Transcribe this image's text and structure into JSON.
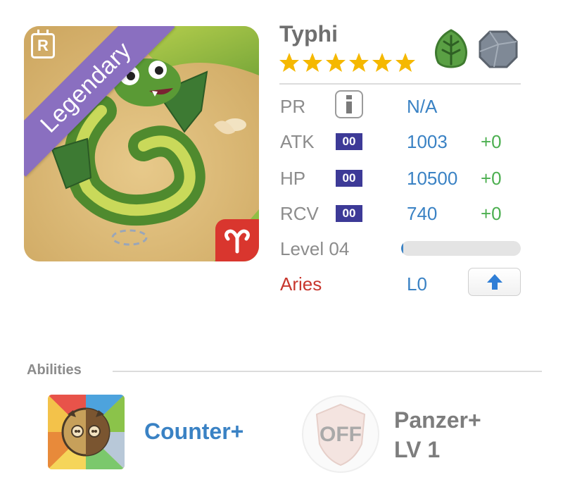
{
  "monster": {
    "name": "Typhi",
    "rarity": "Legendary",
    "rarity_badge": "R",
    "stars": 6,
    "elements": [
      "leaf-element-icon",
      "rock-element-icon"
    ]
  },
  "stats": {
    "pr": {
      "label": "PR",
      "value": "N/A"
    },
    "atk": {
      "label": "ATK",
      "badge": "00",
      "value": "1003",
      "plus": "+0"
    },
    "hp": {
      "label": "HP",
      "badge": "00",
      "value": "10500",
      "plus": "+0"
    },
    "rcv": {
      "label": "RCV",
      "badge": "00",
      "value": "740",
      "plus": "+0"
    }
  },
  "level": {
    "label": "Level 04",
    "progress": 0.02
  },
  "zodiac": {
    "label": "Aries",
    "value": "L0",
    "color": "#c8372e"
  },
  "abilities": {
    "title": "Abilities",
    "items": [
      {
        "name": "Counter+",
        "icon": "counter-ability-icon"
      },
      {
        "name": "Panzer+",
        "level": "LV 1",
        "icon_text": "OFF"
      }
    ]
  },
  "colors": {
    "accent": "#3a82c4",
    "plus": "#4caf50",
    "badge": "#3d3a97",
    "ribbon": "#8a6fc0"
  }
}
